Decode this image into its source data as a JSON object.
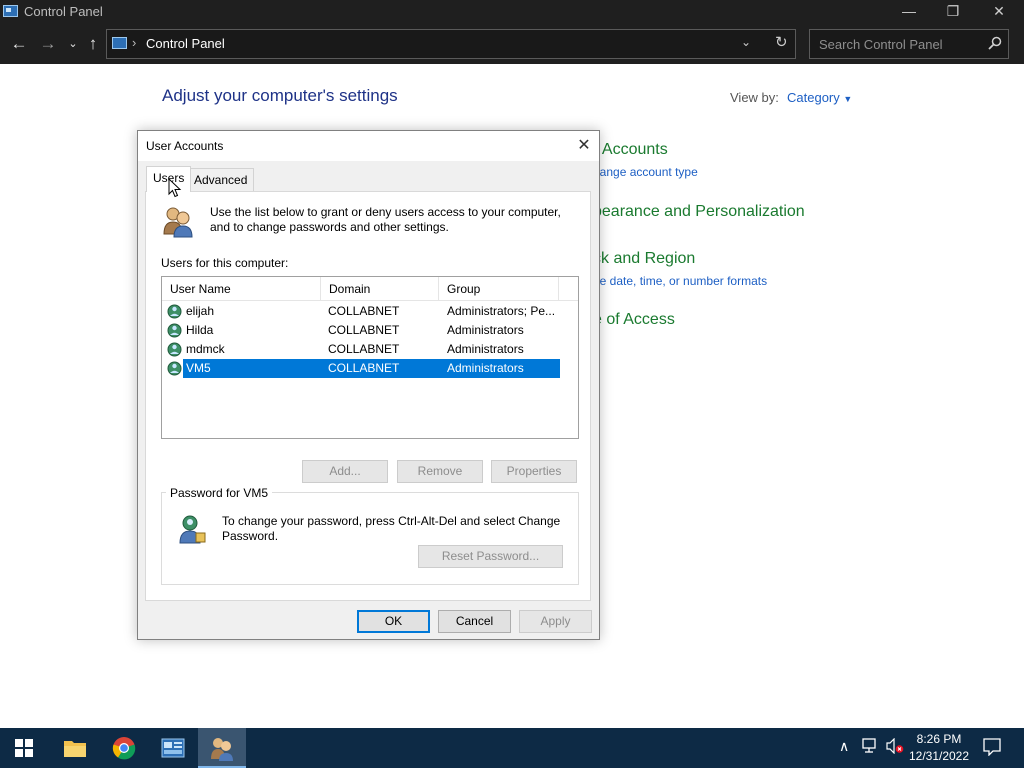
{
  "window": {
    "title": "Control Panel",
    "controls": {
      "minimize": "—",
      "restore": "❐",
      "close": "✕"
    }
  },
  "address_bar": {
    "path": "Control Panel",
    "search_placeholder": "Search Control Panel"
  },
  "content": {
    "heading": "Adjust your computer's settings",
    "view_by_label": "View by:",
    "view_by_value": "Category",
    "categories": [
      {
        "title": "r Accounts",
        "link": "hange account type"
      },
      {
        "title": "pearance and Personalization",
        "link": ""
      },
      {
        "title": "ck and Region",
        "link": "ge date, time, or number formats"
      },
      {
        "title": "e of Access",
        "link": ""
      }
    ]
  },
  "dialog": {
    "title": "User Accounts",
    "tabs": [
      "Users",
      "Advanced"
    ],
    "active_tab": "Users",
    "intro": "Use the list below to grant or deny users access to your computer, and to change passwords and other settings.",
    "users_label": "Users for this computer:",
    "columns": [
      "User Name",
      "Domain",
      "Group"
    ],
    "rows": [
      {
        "user": "elijah",
        "domain": "COLLABNET",
        "group": "Administrators; Pe..."
      },
      {
        "user": "Hilda",
        "domain": "COLLABNET",
        "group": "Administrators"
      },
      {
        "user": "mdmck",
        "domain": "COLLABNET",
        "group": "Administrators"
      },
      {
        "user": "VM5",
        "domain": "COLLABNET",
        "group": "Administrators",
        "selected": true
      }
    ],
    "buttons": {
      "add": "Add...",
      "remove": "Remove",
      "properties": "Properties"
    },
    "password_group": {
      "label": "Password for VM5",
      "text": "To change your password, press Ctrl-Alt-Del and select Change Password.",
      "reset_button": "Reset Password..."
    },
    "footer": {
      "ok": "OK",
      "cancel": "Cancel",
      "apply": "Apply"
    }
  },
  "taskbar": {
    "time": "8:26 PM",
    "date": "12/31/2022",
    "tray_chevron": "∧"
  },
  "colors": {
    "titlebar": "#1f1f1f",
    "heading_blue": "#1e3287",
    "category_green": "#1a7a2f",
    "link_blue": "#1d5fc4",
    "selection": "#0078d7",
    "taskbar": "#0d2a45"
  }
}
